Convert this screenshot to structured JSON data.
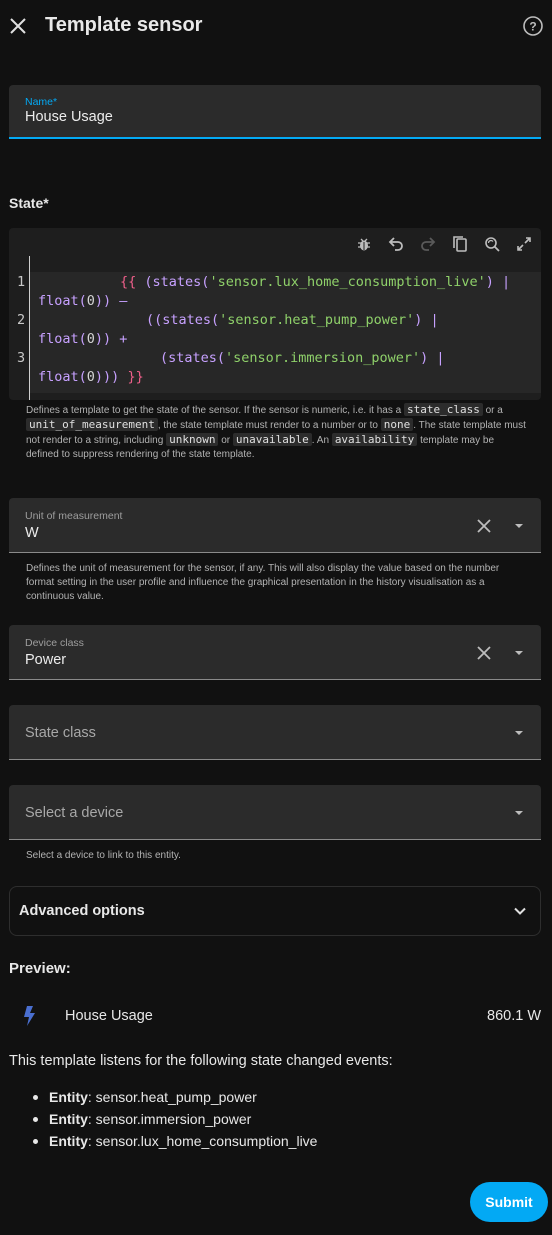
{
  "dialog": {
    "title": "Template sensor"
  },
  "name_field": {
    "label": "Name*",
    "value": "House Usage"
  },
  "state": {
    "label": "State*",
    "lines": [
      {
        "num": "1"
      },
      {
        "num": "2"
      },
      {
        "num": "3"
      }
    ],
    "code": {
      "l1a_brace": "{{",
      "l1a_paren": " (",
      "l1a_fn": "states(",
      "l1a_str": "'sensor.lux_home_consumption_live'",
      "l1a_close": ")",
      "l1a_pipe": " |",
      "l1b_fn": "float(",
      "l1b_num": "0",
      "l1b_close": ")) –",
      "l2a_paren": "((",
      "l2a_fn": "states(",
      "l2a_str": "'sensor.heat_pump_power'",
      "l2a_close": ")",
      "l2a_pipe": " |",
      "l2b_fn": "float(",
      "l2b_num": "0",
      "l2b_close": ")) +",
      "l3a_paren": "(",
      "l3a_fn": "states(",
      "l3a_str": "'sensor.immersion_power'",
      "l3a_close": ")",
      "l3a_pipe": " |",
      "l3b_fn": "float(",
      "l3b_num": "0",
      "l3b_close": ")))",
      "l3b_brace": " }}"
    },
    "helper": {
      "p1": "Defines a template to get the state of the sensor. If the sensor is numeric, i.e. it has a",
      "chip1": "state_class",
      "p2": "or a",
      "chip2": "unit_of_measurement",
      "p3": ", the state template must render to a number or to",
      "chip3": "none",
      "p4": ". The state template must not render to a string, including",
      "chip4": "unknown",
      "p5": "or",
      "chip5": "unavailable",
      "p6": ". An",
      "chip6": "availability",
      "p7": "template may be defined to suppress rendering of the state template."
    }
  },
  "unit_of_measurement": {
    "label": "Unit of measurement",
    "value": "W",
    "helper": "Defines the unit of measurement for the sensor, if any. This will also display the value based on the number format setting in the user profile and influence the graphical presentation in the history visualisation as a continuous value."
  },
  "device_class": {
    "label": "Device class",
    "value": "Power"
  },
  "state_class": {
    "placeholder": "State class"
  },
  "device": {
    "placeholder": "Select a device",
    "helper": "Select a device to link to this entity."
  },
  "advanced": {
    "label": "Advanced options"
  },
  "preview": {
    "label": "Preview:",
    "entity_name": "House Usage",
    "value": "860.1 W",
    "icon": "lightning-bolt-icon",
    "listens_text": "This template listens for the following state changed events:",
    "entities": [
      {
        "prefix": "Entity",
        "id": ": sensor.heat_pump_power"
      },
      {
        "prefix": "Entity",
        "id": ": sensor.immersion_power"
      },
      {
        "prefix": "Entity",
        "id": ": sensor.lux_home_consumption_live"
      }
    ]
  },
  "actions": {
    "submit_label": "Submit"
  },
  "colors": {
    "accent": "#03a9f4",
    "background": "#111111",
    "field_bg": "#2b2b2b",
    "bolt": "#4a6fd0"
  }
}
